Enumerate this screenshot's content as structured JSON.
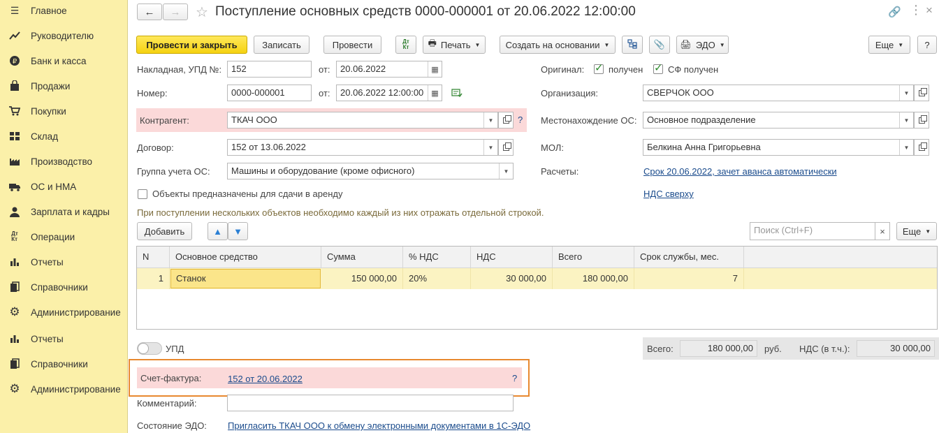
{
  "sidebar": {
    "items": [
      {
        "label": "Главное",
        "icon": "menu-icon"
      },
      {
        "label": "Руководителю",
        "icon": "trend-icon"
      },
      {
        "label": "Банк и касса",
        "icon": "ruble-icon"
      },
      {
        "label": "Продажи",
        "icon": "bag-icon"
      },
      {
        "label": "Покупки",
        "icon": "cart-icon"
      },
      {
        "label": "Склад",
        "icon": "warehouse-icon"
      },
      {
        "label": "Производство",
        "icon": "factory-icon"
      },
      {
        "label": "ОС и НМА",
        "icon": "truck-icon"
      },
      {
        "label": "Зарплата и кадры",
        "icon": "person-icon"
      },
      {
        "label": "Операции",
        "icon": "dt-kt-icon"
      },
      {
        "label": "Отчеты",
        "icon": "bar-chart-icon"
      },
      {
        "label": "Справочники",
        "icon": "books-icon"
      },
      {
        "label": "Администрирование",
        "icon": "gear-icon"
      },
      {
        "label": "Отчеты",
        "icon": "bar-chart-icon"
      },
      {
        "label": "Справочники",
        "icon": "books-icon"
      },
      {
        "label": "Администрирование",
        "icon": "gear-icon"
      }
    ]
  },
  "header": {
    "title": "Поступление основных средств 0000-000001 от 20.06.2022 12:00:00"
  },
  "toolbar": {
    "post_close": "Провести и закрыть",
    "save": "Записать",
    "post": "Провести",
    "print": "Печать",
    "create_based": "Создать на основании",
    "edo": "ЭДО",
    "more": "Еще"
  },
  "form": {
    "invoice_label": "Накладная, УПД №:",
    "invoice_value": "152",
    "from_label": "от:",
    "invoice_date": "20.06.2022",
    "number_label": "Номер:",
    "number_value": "0000-000001",
    "number_date": "20.06.2022 12:00:00",
    "counterparty_label": "Контрагент:",
    "counterparty_value": "ТКАЧ ООО",
    "contract_label": "Договор:",
    "contract_value": "152 от 13.06.2022",
    "group_label": "Группа учета ОС:",
    "group_value": "Машины и оборудование (кроме офисного)",
    "rent_label": "Объекты предназначены для сдачи в аренду",
    "original_label": "Оригинал:",
    "received_label": "получен",
    "sf_received_label": "СФ получен",
    "org_label": "Организация:",
    "org_value": "СВЕРЧОК ООО",
    "location_label": "Местонахождение ОС:",
    "location_value": "Основное подразделение",
    "mol_label": "МОЛ:",
    "mol_value": "Белкина Анна Григорьевна",
    "payments_label": "Расчеты:",
    "payments_link": "Срок 20.06.2022, зачет аванса автоматически",
    "vat_link": "НДС сверху",
    "hint": "При поступлении нескольких объектов необходимо каждый из них отражать отдельной строкой.",
    "help": "?"
  },
  "table_toolbar": {
    "add": "Добавить",
    "search_placeholder": "Поиск (Ctrl+F)",
    "clear": "×",
    "more": "Еще"
  },
  "table": {
    "headers": [
      "N",
      "Основное средство",
      "Сумма",
      "% НДС",
      "НДС",
      "Всего",
      "Срок службы, мес."
    ],
    "rows": [
      [
        "1",
        "Станок",
        "150 000,00",
        "20%",
        "30 000,00",
        "180 000,00",
        "7"
      ]
    ]
  },
  "footer": {
    "upd_label": "УПД",
    "total_label": "Всего:",
    "total_value": "180 000,00",
    "currency": "руб.",
    "vat_incl_label": "НДС (в т.ч.):",
    "vat_incl_value": "30 000,00",
    "invoice_fact_label": "Счет-фактура:",
    "invoice_fact_link": "152 от 20.06.2022",
    "comment_label": "Комментарий:",
    "comment_value": "",
    "edo_state_label": "Состояние ЭДО:",
    "edo_state_link": "Пригласить ТКАЧ ООО к обмену электронными документами в 1С-ЭДО"
  },
  "colors": {
    "sidebar_bg": "#fbf0a9",
    "primary_button": "#f5d211",
    "highlight_pink": "#fbd9d9",
    "row_selected": "#fbf3c2",
    "focus_orange": "#e8892f",
    "link": "#1a4b8c"
  }
}
